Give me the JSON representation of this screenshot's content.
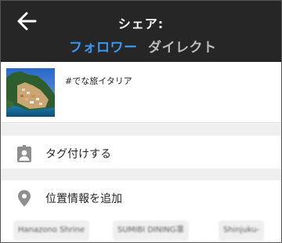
{
  "header": {
    "title": "シェア:",
    "tabs": [
      {
        "label": "フォロワー",
        "active": true
      },
      {
        "label": "ダイレクト",
        "active": false
      }
    ]
  },
  "post": {
    "caption": "#でな旅イタリア"
  },
  "options": [
    {
      "label": "タグ付けする",
      "icon": "tag-person-icon"
    },
    {
      "label": "位置情報を追加",
      "icon": "location-pin-icon"
    }
  ],
  "location_suggestions": [
    "Hanazono Shrine",
    "SUMIBI DINING凛",
    "Shinjuku-"
  ],
  "colors": {
    "header_bg": "#262626",
    "active_tab": "#3897f0",
    "inactive_tab": "#bdbdbd",
    "icon_gray": "#8e8e8e",
    "divider_band": "#efefef"
  }
}
